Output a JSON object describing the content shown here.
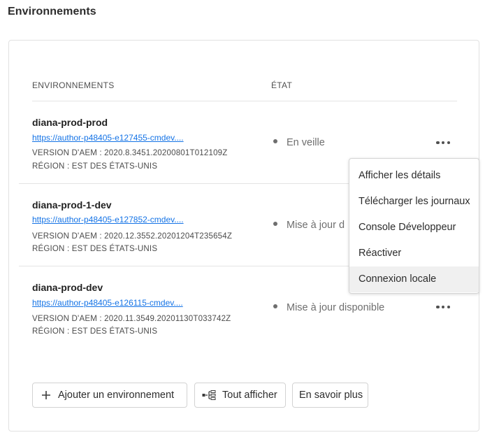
{
  "page": {
    "title": "Environnements"
  },
  "table": {
    "headers": {
      "env": "ENVIRONNEMENTS",
      "status": "ÉTAT"
    },
    "rows": [
      {
        "name": "diana-prod-prod",
        "link": "https://author-p48405-e127455-cmdev....",
        "version": "VERSION D'AEM  : 2020.8.3451.20200801T012109Z",
        "region": "RÉGION : EST DES ÉTATS-UNIS",
        "status": "En veille"
      },
      {
        "name": "diana-prod-1-dev",
        "link": "https://author-p48405-e127852-cmdev....",
        "version": "VERSION D'AEM  : 2020.12.3552.20201204T235654Z",
        "region": "RÉGION : EST DES ÉTATS-UNIS",
        "status": "Mise à jour d"
      },
      {
        "name": "diana-prod-dev",
        "link": "https://author-p48405-e126115-cmdev....",
        "version": "VERSION D'AEM  : 2020.11.3549.20201130T033742Z",
        "region": "RÉGION : EST DES ÉTATS-UNIS",
        "status": "Mise à jour disponible"
      }
    ]
  },
  "menu": {
    "items": [
      "Afficher les détails",
      "Télécharger les journaux",
      "Console Développeur",
      "Réactiver",
      "Connexion locale"
    ],
    "highlighted_index": 4
  },
  "actions": {
    "add": "Ajouter un environnement",
    "show_all": "Tout afficher",
    "learn_more": "En savoir plus"
  },
  "icons": {
    "add": "plus-icon",
    "show_all": "tree-view-icon",
    "more": "more-horizontal-icon"
  },
  "colors": {
    "link": "#1473e6",
    "status": "#6e6e6e",
    "menu_highlight": "#f0f0f0"
  }
}
